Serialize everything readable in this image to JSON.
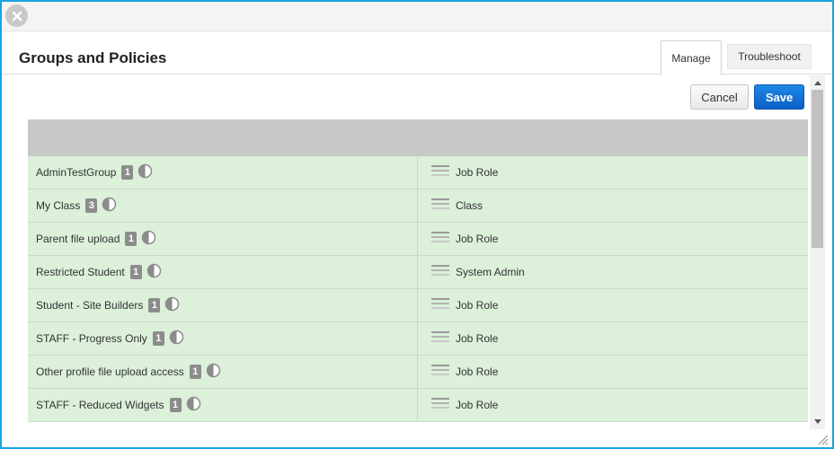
{
  "header": {
    "title": "Groups and Policies"
  },
  "tabs": [
    {
      "label": "Manage"
    },
    {
      "label": "Troubleshoot"
    }
  ],
  "actions": {
    "cancel_label": "Cancel",
    "save_label": "Save"
  },
  "rows": [
    {
      "name": "AdminTestGroup",
      "count": "1",
      "policy": "Job Role"
    },
    {
      "name": "My Class",
      "count": "3",
      "policy": "Class"
    },
    {
      "name": "Parent file upload",
      "count": "1",
      "policy": "Job Role"
    },
    {
      "name": "Restricted Student",
      "count": "1",
      "policy": "System Admin"
    },
    {
      "name": "Student - Site Builders",
      "count": "1",
      "policy": "Job Role"
    },
    {
      "name": "STAFF - Progress Only",
      "count": "1",
      "policy": "Job Role"
    },
    {
      "name": "Other profile file upload access",
      "count": "1",
      "policy": "Job Role"
    },
    {
      "name": "STAFF - Reduced Widgets",
      "count": "1",
      "policy": "Job Role"
    }
  ],
  "icons": {
    "close": "close-icon",
    "status": "half-circle-icon",
    "policy": "list-lines-icon"
  },
  "colors": {
    "accent_border": "#1aa3e0",
    "row_bg": "#dcf0da",
    "save_bg": "#1a7fe0"
  }
}
